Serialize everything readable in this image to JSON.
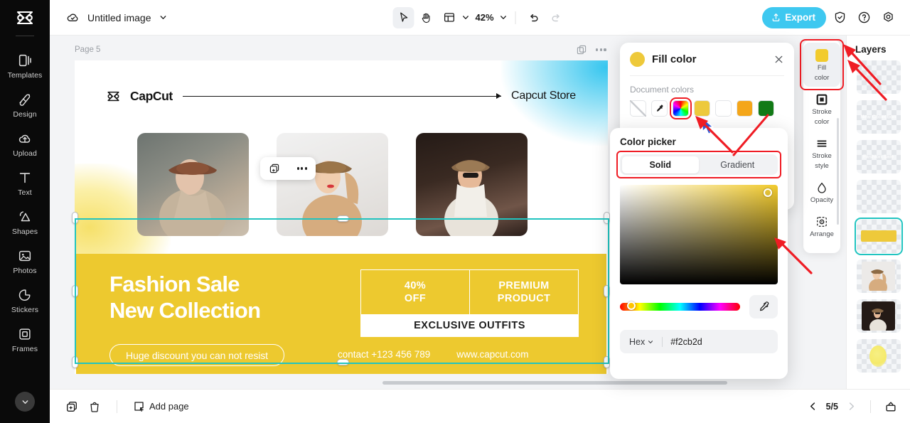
{
  "app": {
    "brand_logo": "capcut-logo-icon",
    "accent_cyan": "#3ec8f0",
    "selection_teal": "#21c4c0",
    "highlight_red": "#ef1c24",
    "brand_yellow": "#f2cb2d"
  },
  "left_rail": {
    "items": [
      {
        "label": "Templates",
        "icon": "templates-icon"
      },
      {
        "label": "Design",
        "icon": "design-icon"
      },
      {
        "label": "Upload",
        "icon": "upload-cloud-icon"
      },
      {
        "label": "Text",
        "icon": "text-t-icon"
      },
      {
        "label": "Shapes",
        "icon": "shapes-icon"
      },
      {
        "label": "Photos",
        "icon": "photos-image-icon"
      },
      {
        "label": "Stickers",
        "icon": "stickers-icon"
      },
      {
        "label": "Frames",
        "icon": "frames-icon"
      }
    ],
    "collapse_icon": "chevron-down-icon"
  },
  "topbar": {
    "cloud_icon": "cloud-saved-icon",
    "doc_title": "Untitled image",
    "doc_caret": "chevron-down-icon",
    "tools": [
      {
        "name": "select-tool",
        "icon": "cursor-arrow-icon",
        "active": true
      },
      {
        "name": "hand-tool",
        "icon": "hand-icon",
        "active": false
      },
      {
        "name": "layout-tool",
        "icon": "layout-grid-icon",
        "active": false
      }
    ],
    "layout_caret": "chevron-down-icon",
    "zoom_value": "42%",
    "zoom_caret": "chevron-down-icon",
    "undo_icon": "undo-icon",
    "redo_icon": "redo-icon",
    "export_label": "Export",
    "export_icon": "export-upload-icon",
    "shield_icon": "shield-check-icon",
    "help_icon": "help-question-icon",
    "settings_icon": "gear-icon"
  },
  "canvas": {
    "page_label": "Page 5",
    "page_duplicate_icon": "duplicate-icon",
    "page_more_icon": "more-dots-icon",
    "float_toolbar": {
      "duplicate_icon": "duplicate-plus-icon",
      "more_icon": "more-dots-icon"
    },
    "design": {
      "logo_text": "CapCut",
      "logo_icon": "capcut-mark-icon",
      "store_text": "Capcut Store",
      "arrow_icon": "long-arrow-right-icon",
      "photos": [
        {
          "name": "model-photo-1"
        },
        {
          "name": "model-photo-2"
        },
        {
          "name": "model-photo-3"
        }
      ],
      "headline_line1": "Fashion Sale",
      "headline_line2": "New Collection",
      "pill_text": "Huge discount you can not resist",
      "offer_discount_line1": "40%",
      "offer_discount_line2": "OFF",
      "offer_premium_line1": "PREMIUM",
      "offer_premium_line2": "PRODUCT",
      "offer_footer": "EXCLUSIVE OUTFITS",
      "contact_phone": "contact +123 456 789",
      "website": "www.capcut.com",
      "banner_color": "#edc92f"
    }
  },
  "fill_panel": {
    "title": "Fill color",
    "swatch_color": "#eec93a",
    "close_icon": "close-x-icon",
    "document_colors_label": "Document colors",
    "swatches": [
      {
        "name": "no-color-swatch",
        "color": "none",
        "type": "none"
      },
      {
        "name": "eyedropper-swatch",
        "color": "#ffffff",
        "type": "eyedropper"
      },
      {
        "name": "rainbow-picker-swatch",
        "color": "rainbow",
        "type": "rainbow",
        "highlighted": true
      },
      {
        "name": "yellow-swatch",
        "color": "#edc93c",
        "type": "solid"
      },
      {
        "name": "white-swatch",
        "color": "#ffffff",
        "type": "solid"
      },
      {
        "name": "orange-swatch",
        "color": "#f4a61a",
        "type": "solid"
      },
      {
        "name": "green-swatch",
        "color": "#127a16",
        "type": "solid"
      }
    ]
  },
  "color_picker": {
    "title": "Color picker",
    "tabs": [
      {
        "label": "Solid",
        "active": true
      },
      {
        "label": "Gradient",
        "active": false
      }
    ],
    "eyedropper_icon": "eyedropper-icon",
    "hex_label": "Hex",
    "hex_caret": "chevron-down-icon",
    "hex_value": "#f2cb2d"
  },
  "tool_rail": {
    "items": [
      {
        "label_line1": "Fill",
        "label_line2": "color",
        "icon": "fill-color-chip-icon",
        "selected": true
      },
      {
        "label_line1": "Stroke",
        "label_line2": "color",
        "icon": "stroke-square-icon",
        "selected": false
      },
      {
        "label_line1": "Stroke",
        "label_line2": "style",
        "icon": "stroke-lines-icon",
        "selected": false
      },
      {
        "label_line1": "Opacity",
        "label_line2": "",
        "icon": "opacity-drop-icon",
        "selected": false
      },
      {
        "label_line1": "Arrange",
        "label_line2": "",
        "icon": "arrange-icon",
        "selected": false
      }
    ]
  },
  "layers": {
    "title": "Layers",
    "items": [
      {
        "name": "layer-empty-1",
        "kind": "empty"
      },
      {
        "name": "layer-text-new-collection",
        "kind": "text",
        "text": "New Collection"
      },
      {
        "name": "layer-text-fashion-sale",
        "kind": "text",
        "text": "Fashion Sale"
      },
      {
        "name": "layer-empty-2",
        "kind": "empty"
      },
      {
        "name": "layer-yellow-banner",
        "kind": "shape",
        "color": "#eec93a",
        "active": true
      },
      {
        "name": "layer-photo-model-2",
        "kind": "photo"
      },
      {
        "name": "layer-photo-model-3",
        "kind": "photo"
      },
      {
        "name": "layer-yellow-glow",
        "kind": "blob"
      }
    ]
  },
  "bottombar": {
    "duplicate_icon": "duplicate-icon",
    "delete_icon": "trash-icon",
    "add_page_label": "Add page",
    "add_page_icon": "add-page-icon",
    "prev_icon": "chevron-left-icon",
    "page_indicator": "5/5",
    "next_icon": "chevron-right-icon",
    "present_icon": "present-icon"
  }
}
